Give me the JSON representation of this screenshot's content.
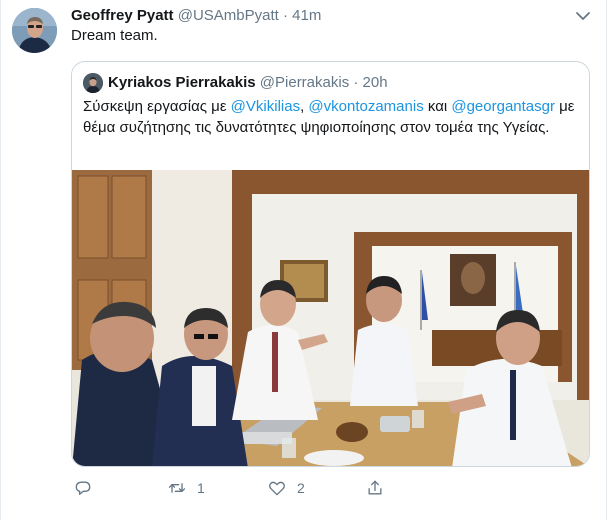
{
  "tweet": {
    "author_name": "Geoffrey Pyatt",
    "author_handle": "@USAmbPyatt",
    "separator": "·",
    "time": "41m",
    "text": "Dream team."
  },
  "quoted": {
    "author_name": "Kyriakos Pierrakakis",
    "author_handle": "@Pierrakakis",
    "separator": "·",
    "time": "20h",
    "text_part1": "Σύσκεψη εργασίας με ",
    "mention1": "@Vkikilias",
    "text_part2": ", ",
    "mention2": "@vkontozamanis",
    "text_part3": " και ",
    "mention3": "@georgantasgr",
    "text_part4": " με θέμα συζήτησης τις δυνατότητες ψηφιοποίησης στον τομέα της Υγείας."
  },
  "actions": {
    "reply_icon": "reply-icon",
    "retweet_icon": "retweet-icon",
    "retweet_count": "1",
    "like_icon": "heart-icon",
    "like_count": "2",
    "share_icon": "share-icon"
  },
  "colors": {
    "text": "#14171a",
    "secondary": "#657786",
    "link": "#1b95e0",
    "border": "#ccd6dd"
  }
}
